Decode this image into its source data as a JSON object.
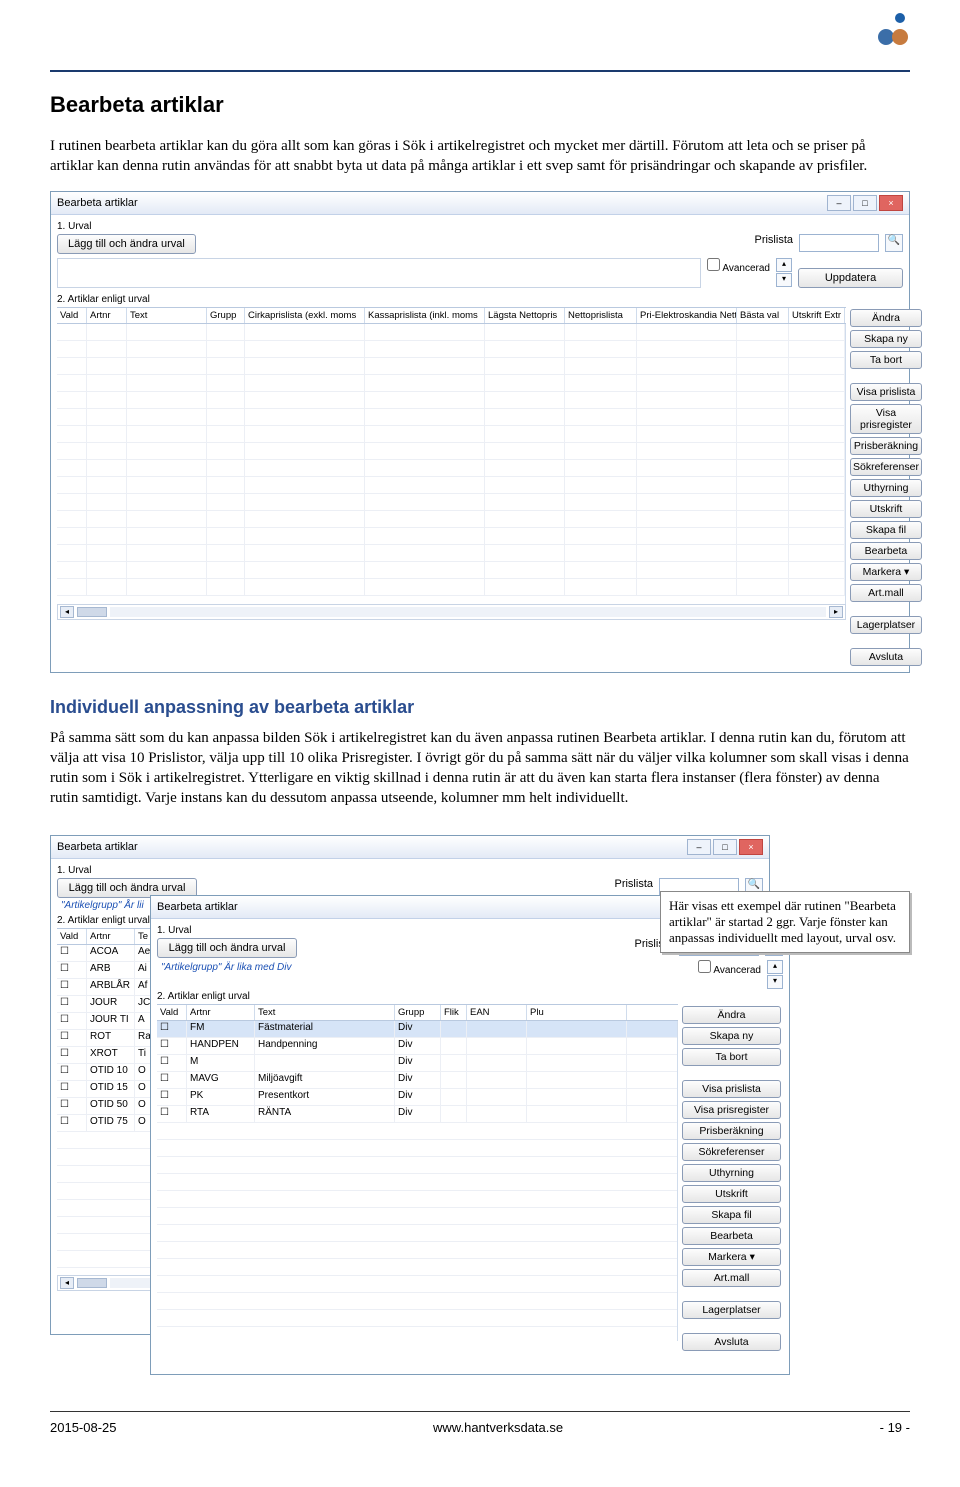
{
  "doc": {
    "heading": "Bearbeta artiklar",
    "para1": "I rutinen bearbeta artiklar kan du göra allt som kan göras i Sök i artikelregistret och mycket mer därtill. Förutom att leta och se priser på artiklar kan denna rutin användas för att snabbt byta ut data på många artiklar i ett svep samt för prisändringar och skapande av prisfiler.",
    "subheading": "Individuell anpassning av bearbeta artiklar",
    "para2": "På samma sätt som du kan anpassa bilden Sök i artikelregistret kan du även anpassa rutinen Bearbeta artiklar. I denna rutin kan du, förutom att välja att visa 10 Prislistor, välja upp till 10 olika Prisregister. I övrigt gör du på samma sätt när du väljer vilka kolumner som skall visas i denna rutin som i Sök i artikelregistret. Ytterligare en viktig skillnad i denna rutin är att du även kan starta flera instanser (flera fönster) av denna rutin samtidigt. Varje instans kan du dessutom anpassa utseende, kolumner mm helt individuellt.",
    "callout": "Här visas ett exempel där rutinen \"Bearbeta artiklar\" är startad 2 ggr. Varje fönster kan anpassas individuellt med layout, urval osv."
  },
  "win": {
    "title": "Bearbeta artiklar",
    "section1": "1. Urval",
    "urvalBtn": "Lägg till och ändra urval",
    "prislista": "Prislista",
    "avancerad": "Avancerad",
    "section2": "2. Artiklar enligt urval",
    "filterDiv": "\"Artikelgrupp\" Är lika med Div",
    "filterAr": "\"Artikelgrupp\" År lii"
  },
  "cols1": [
    "Vald",
    "Artnr",
    "Text",
    "Grupp",
    "Cirkaprislista (exkl. moms",
    "Kassaprislista (inkl. moms",
    "Lägsta Nettopris",
    "Nettoprislista",
    "Pri-Elektroskandia Nett",
    "Bästa val",
    "Utskrift Extr"
  ],
  "cols2a": [
    "Vald",
    "Artnr",
    "Te"
  ],
  "cols2b": [
    "Vald",
    "Artnr",
    "Text",
    "Grupp",
    "Flik",
    "EAN",
    "Plu"
  ],
  "rows2": [
    "ACOA",
    "ARB",
    "ARBLÅR",
    "JOUR",
    "JOUR TI",
    "ROT",
    "XROT",
    "OTID 10",
    "OTID 15",
    "OTID 50",
    "OTID 75"
  ],
  "rows2b": [
    "Ae",
    "Ai",
    "Af",
    "JC",
    "A",
    "Ra",
    "Ti",
    "O",
    "O",
    "O",
    "O"
  ],
  "rows3": [
    {
      "artnr": "FM",
      "text": "Fästmaterial",
      "grupp": "Div"
    },
    {
      "artnr": "HANDPEN",
      "text": "Handpenning",
      "grupp": "Div"
    },
    {
      "artnr": "M",
      "text": "",
      "grupp": "Div"
    },
    {
      "artnr": "MAVG",
      "text": "Miljöavgift",
      "grupp": "Div"
    },
    {
      "artnr": "PK",
      "text": "Presentkort",
      "grupp": "Div"
    },
    {
      "artnr": "RTA",
      "text": "RÄNTA",
      "grupp": "Div"
    }
  ],
  "btns": {
    "uppdatera": "Uppdatera",
    "andra": "Ändra",
    "skapany": "Skapa ny",
    "tabort": "Ta bort",
    "visaprislista": "Visa prislista",
    "visaprisregister": "Visa prisregister",
    "prisberakning": "Prisberäkning",
    "sokreferenser": "Sökreferenser",
    "uthyrning": "Uthyrning",
    "utskrift": "Utskrift",
    "skapafil": "Skapa fil",
    "bearbeta": "Bearbeta",
    "markera": "Markera",
    "artmall": "Art.mall",
    "lagerplatser": "Lagerplatser",
    "avsluta": "Avsluta"
  },
  "footer": {
    "date": "2015-08-25",
    "url": "www.hantverksdata.se",
    "page": "- 19 -"
  }
}
